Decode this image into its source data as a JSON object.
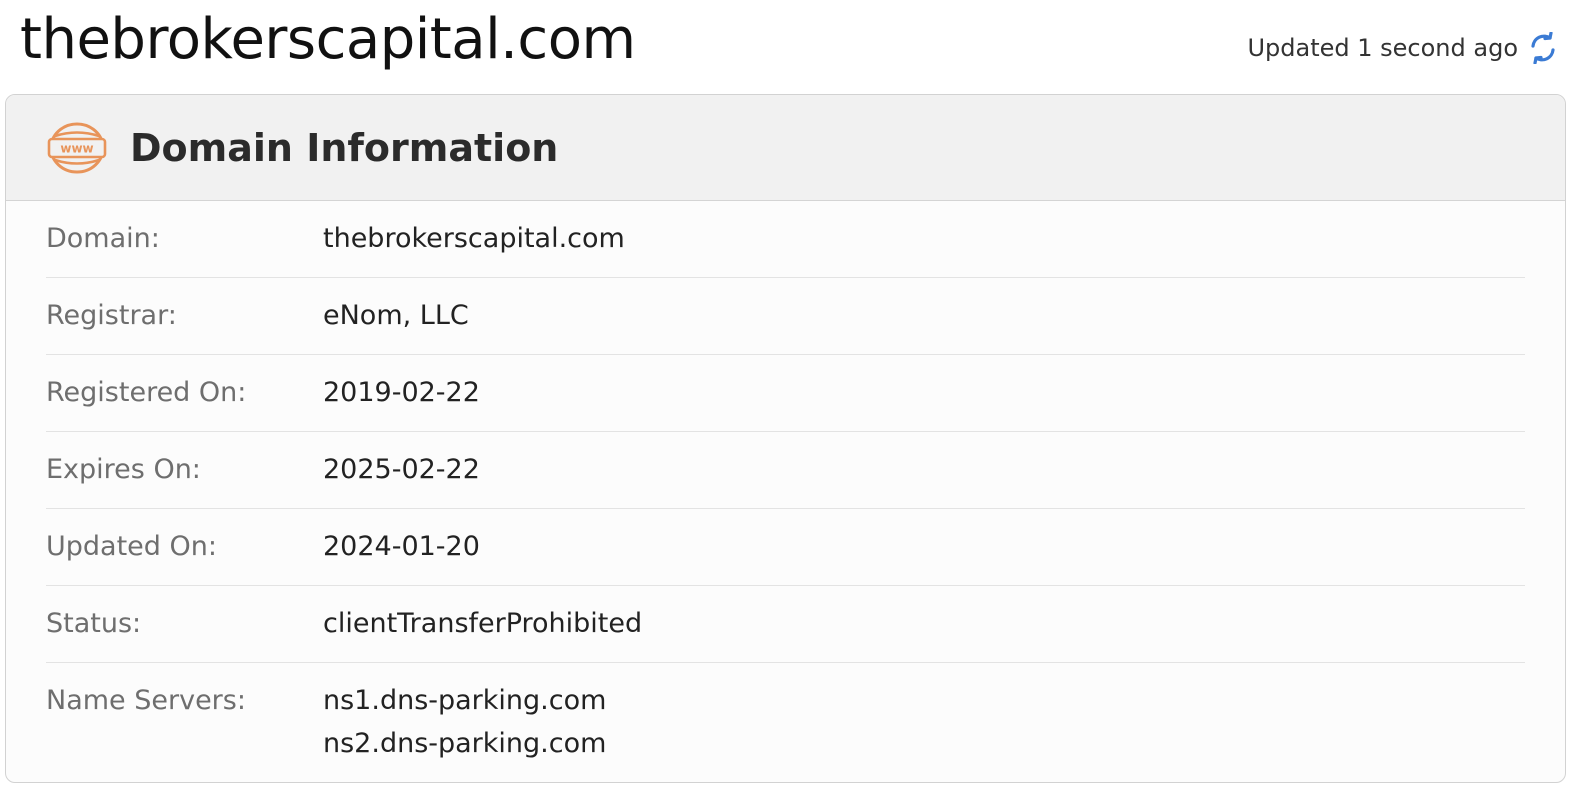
{
  "page": {
    "title": "thebrokerscapital.com",
    "updated_text": "Updated 1 second ago"
  },
  "card": {
    "title": "Domain Information",
    "icon_text": "www",
    "rows": [
      {
        "label": "Domain:",
        "value": "thebrokerscapital.com"
      },
      {
        "label": "Registrar:",
        "value": "eNom, LLC"
      },
      {
        "label": "Registered On:",
        "value": "2019-02-22"
      },
      {
        "label": "Expires On:",
        "value": "2025-02-22"
      },
      {
        "label": "Updated On:",
        "value": "2024-01-20"
      },
      {
        "label": "Status:",
        "value": "clientTransferProhibited"
      }
    ],
    "name_servers": {
      "label": "Name Servers:",
      "values": [
        "ns1.dns-parking.com",
        "ns2.dns-parking.com"
      ]
    }
  },
  "icons": {
    "refresh": "refresh-icon",
    "www": "www-globe-icon"
  },
  "colors": {
    "accent_orange": "#e8945a",
    "refresh_blue": "#3b7bd4",
    "header_bg": "#f1f1f1"
  }
}
